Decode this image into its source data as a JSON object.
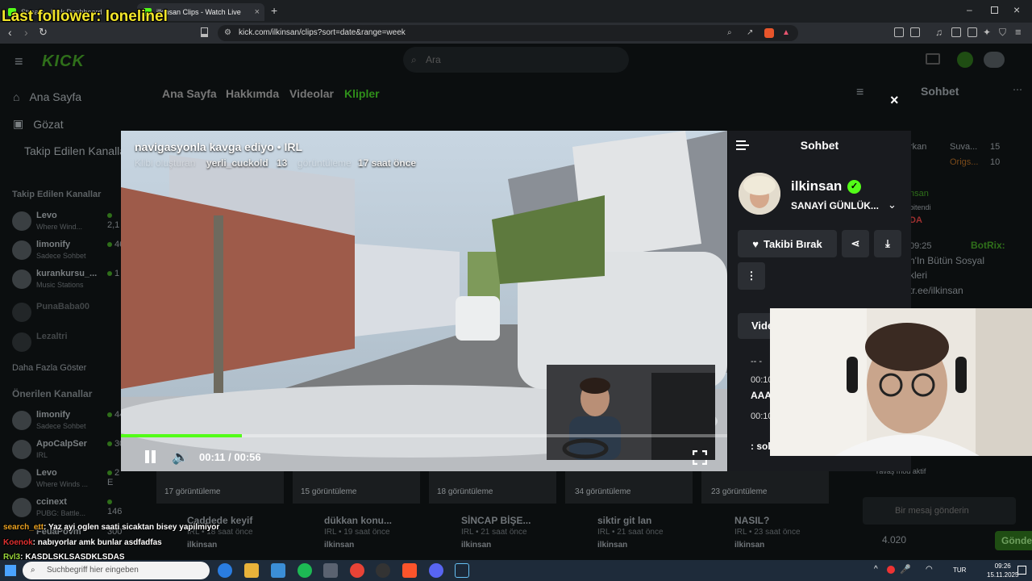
{
  "overlay": {
    "last_follower": "Last follower: lonelinel"
  },
  "browser": {
    "tabs": [
      {
        "label": "Stream - Kick Dashboard",
        "active": false
      },
      {
        "label": "ilkinsan Clips - Watch Live on",
        "active": true
      }
    ],
    "url": "kick.com/ilkinsan/clips?sort=date&range=week"
  },
  "kick": {
    "search_placeholder": "Ara",
    "nav": {
      "home": "Ana Sayfa",
      "browse": "Gözat",
      "following": "Takip Edilen Kanallar"
    },
    "followed_header": "Takip Edilen Kanallar",
    "followed": [
      {
        "name": "Levo",
        "sub": "Where Wind...",
        "viewers": "2,1"
      },
      {
        "name": "limonify",
        "sub": "Sadece Sohbet",
        "viewers": "46"
      },
      {
        "name": "kurankursu_...",
        "sub": "Music Stations",
        "viewers": "1"
      },
      {
        "name": "PunaBaba00",
        "sub": "",
        "viewers": ""
      },
      {
        "name": "Lezaltri",
        "sub": "",
        "viewers": ""
      }
    ],
    "show_more": "Daha Fazla Göster",
    "recommended_header": "Önerilen Kanallar",
    "recommended": [
      {
        "name": "limonify",
        "sub": "Sadece Sohbet",
        "viewers": "44"
      },
      {
        "name": "ApoCalpSer",
        "sub": "IRL",
        "viewers": "30"
      },
      {
        "name": "Levo",
        "sub": "Where Winds ...",
        "viewers": "2 E"
      },
      {
        "name": "ccinext",
        "sub": "PUBG: Battle...",
        "viewers": "146"
      },
      {
        "name": "FeuaPovm",
        "sub": "",
        "viewers": "300"
      }
    ],
    "profile_tabs": {
      "home": "Ana Sayfa",
      "about": "Hakkımda",
      "videos": "Videolar",
      "clips": "Klipler"
    },
    "clips": [
      {
        "views": "17 görüntüleme",
        "title": "Caddede keyif",
        "sub": "IRL • 18 saat önce",
        "user": "ilkinsan"
      },
      {
        "views": "15 görüntüleme",
        "title": "dükkan konu...",
        "sub": "IRL • 19 saat önce",
        "user": "ilkinsan"
      },
      {
        "views": "18 görüntüleme",
        "title": "SİNCAP BİŞE...",
        "sub": "IRL • 21 saat önce",
        "user": "ilkinsan"
      },
      {
        "views": "34 görüntüleme",
        "title": "siktir git lan",
        "sub": "IRL • 21 saat önce",
        "user": "ilkinsan"
      },
      {
        "views": "23 görüntüleme",
        "title": "NASIL?",
        "sub": "IRL • 23 saat önce",
        "user": "ilkinsan"
      }
    ],
    "right_chat": {
      "header": "Sohbet",
      "lines": [
        "rkan",
        "Suva...",
        "15",
        "Origs...",
        "10",
        "nsan",
        "bitendi",
        "DA",
        "09:25",
        "BotRix:",
        "n'In Bütün Sosyal",
        "kleri",
        "tr.ee/ilkinsan"
      ],
      "mode_text": "Yavaş mod aktif",
      "input_placeholder": "Bir mesaj gönderin",
      "viewers": "4.020",
      "send": "Gönder"
    }
  },
  "clip_modal": {
    "title": "navigasyonla kavga ediyo",
    "category": "IRL",
    "clipped_by_label": "Klibi oluşturan",
    "clipper": "yerli_cuckold",
    "views": "13",
    "views_label": "görüntüleme",
    "time_ago": "17 saat önce",
    "progress": 0.2,
    "time": "00:11 / 00:56",
    "close": "×",
    "chat": {
      "title": "Sohbet",
      "streamer": "ilkinsan",
      "category": "SANAYİ GÜNLÜK...",
      "unfollow": "Takibi Bırak",
      "videos_tab": "Videolar",
      "lines": [
        "-- -",
        "00:10",
        "AAA",
        "00:10",
        ": sol"
      ]
    }
  },
  "overlay_chat": [
    {
      "user": "search_ett",
      "color": "#e8a020",
      "text": ": Yaz ayi oglen saati sicaktan bisey yapilmiyor"
    },
    {
      "user": "Koenok",
      "color": "#e03030",
      "text": ": nabıyorlar amk bunlar asdfadfas"
    },
    {
      "user": "Rvl3",
      "color": "#9ad63a",
      "text": ": KASDLSKLSASDKLSDAS"
    }
  ],
  "taskbar": {
    "search_placeholder": "Suchbegriff hier eingeben",
    "lang": "TUR",
    "time": "09:26",
    "date": "15.11.2025"
  }
}
